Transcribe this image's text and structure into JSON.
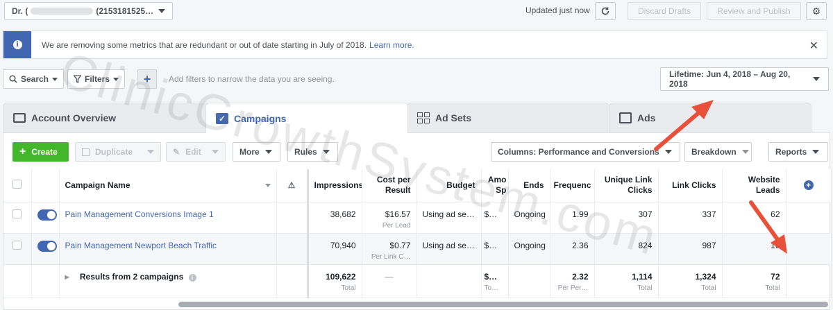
{
  "topbar": {
    "account_name": "Dr. (",
    "account_id": "(2153181525…",
    "updated": "Updated just now",
    "discard": "Discard Drafts",
    "review": "Review and Publish"
  },
  "notice": {
    "message": "We are removing some metrics that are redundant or out of date starting in July of 2018.",
    "link": "Learn more."
  },
  "filterbar": {
    "search": "Search",
    "filters": "Filters",
    "hint": "Add filters to narrow the data you are seeing.",
    "daterange": "Lifetime: Jun 4, 2018 – Aug 20, 2018"
  },
  "tabs": [
    {
      "label": "Account Overview"
    },
    {
      "label": "Campaigns"
    },
    {
      "label": "Ad Sets"
    },
    {
      "label": "Ads"
    }
  ],
  "toolbar": {
    "create": "Create",
    "duplicate": "Duplicate",
    "edit": "Edit",
    "more": "More",
    "rules": "Rules",
    "columns": "Columns: Performance and Conversions",
    "breakdown": "Breakdown",
    "reports": "Reports"
  },
  "table": {
    "headers": {
      "name": "Campaign Name",
      "impressions": "Impressions",
      "cost_per_result": "Cost per Result",
      "budget": "Budget",
      "amount_spent": "Amo Sp",
      "ends": "Ends",
      "frequency": "Frequenc",
      "unique_link_clicks": "Unique Link Clicks",
      "link_clicks": "Link Clicks",
      "website_leads": "Website Leads"
    },
    "rows": [
      {
        "name": "Pain Management Conversions Image 1",
        "impressions": "38,682",
        "cost_per_result": "$16.57",
        "cost_sub": "Per Lead",
        "budget": "Using ad se…",
        "amount_spent": "$…",
        "ends": "Ongoing",
        "frequency": "1.99",
        "unique_link_clicks": "307",
        "link_clicks": "337",
        "website_leads": "62"
      },
      {
        "name": "Pain Management Newport Beach Traffic",
        "impressions": "70,940",
        "cost_per_result": "$0.77",
        "cost_sub": "Per Link C…",
        "budget": "Using ad se…",
        "amount_spent": "$…",
        "ends": "Ongoing",
        "frequency": "2.36",
        "unique_link_clicks": "824",
        "link_clicks": "987",
        "website_leads": "10"
      }
    ],
    "total": {
      "label": "Results from 2 campaigns",
      "impressions": "109,622",
      "impressions_sub": "Total",
      "cost_per_result": "—",
      "amount_spent": "$…",
      "amount_sub": "To…",
      "frequency": "2.32",
      "frequency_sub": "Per Per…",
      "unique_link_clicks": "1,114",
      "unique_sub": "Total",
      "link_clicks": "1,324",
      "link_sub": "Total",
      "website_leads": "72",
      "leads_sub": "Total"
    }
  },
  "watermark": "ClinicGrowthSystem.com",
  "colors": {
    "brand": "#4267b2",
    "create": "#42b72a",
    "arrow": "#e8503a"
  }
}
